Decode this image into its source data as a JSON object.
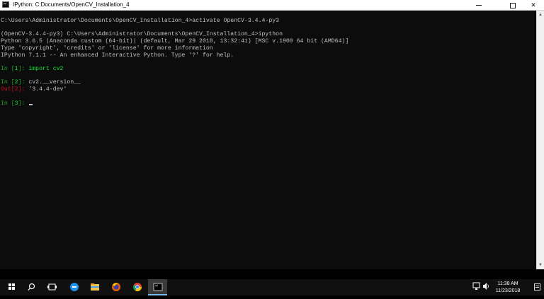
{
  "window": {
    "title": "IPython: C:Documents/OpenCV_Installation_4",
    "controls": {
      "minimize": "minimize",
      "maximize": "maximize",
      "close": "✕"
    }
  },
  "console": {
    "line1": "C:\\Users\\Administrator\\Documents\\OpenCV_Installation_4>activate OpenCV-3.4.4-py3",
    "line2": "(OpenCV-3.4.4-py3) C:\\Users\\Administrator\\Documents\\OpenCV_Installation_4>ipython",
    "line3": "Python 3.6.5 |Anaconda custom (64-bit)| (default, Mar 29 2018, 13:32:41) [MSC v.1900 64 bit (AMD64)]",
    "line4": "Type 'copyright', 'credits' or 'license' for more information",
    "line5": "IPython 7.1.1 -- An enhanced Interactive Python. Type '?' for help.",
    "in1_prefix": "In [",
    "in1_num": "1",
    "in1_suffix": "]: ",
    "in1_code": "import cv2",
    "in2_prefix": "In [",
    "in2_num": "2",
    "in2_suffix": "]: ",
    "in2_code": "cv2.__version__",
    "out2_prefix": "Out[",
    "out2_num": "2",
    "out2_suffix": "]: ",
    "out2_value": "'3.4.4-dev'",
    "in3_prefix": "In [",
    "in3_num": "3",
    "in3_suffix": "]: "
  },
  "taskbar": {
    "icons": [
      "windows-start-icon",
      "search-icon",
      "task-view-icon",
      "edge-icon",
      "file-explorer-icon",
      "firefox-icon",
      "chrome-icon",
      "terminal-icon"
    ],
    "time": "11:38 AM",
    "date": "11/23/2018"
  },
  "colors": {
    "prompt_green": "#16a823",
    "keyword_green": "#13e33a",
    "out_red": "#c50f1f",
    "console_bg": "#0c0c0c",
    "taskbar_bg": "#101010"
  }
}
